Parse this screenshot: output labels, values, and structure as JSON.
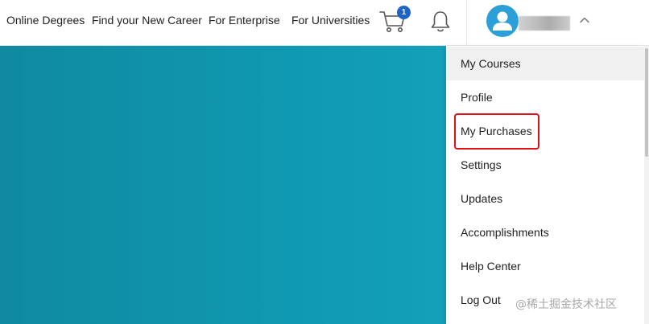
{
  "nav": {
    "links": [
      "Online Degrees",
      "Find your New Career",
      "For Enterprise",
      "For Universities"
    ],
    "cart_icon": "shopping-cart-icon",
    "cart_count": "1",
    "bell_icon": "bell-icon",
    "avatar_icon": "user-avatar-icon",
    "chevron_icon": "chevron-up-icon"
  },
  "menu": {
    "items": [
      "My Courses",
      "Profile",
      "My Purchases",
      "Settings",
      "Updates",
      "Accomplishments",
      "Help Center",
      "Log Out"
    ],
    "active_item": "My Courses",
    "highlighted_item": "My Purchases"
  },
  "colors": {
    "brand_blue": "#1f63c6",
    "avatar_blue": "#2a9fd8",
    "hero_teal": "#1099b2",
    "highlight_red": "#e0101a"
  },
  "watermark": "@稀土掘金技术社区"
}
